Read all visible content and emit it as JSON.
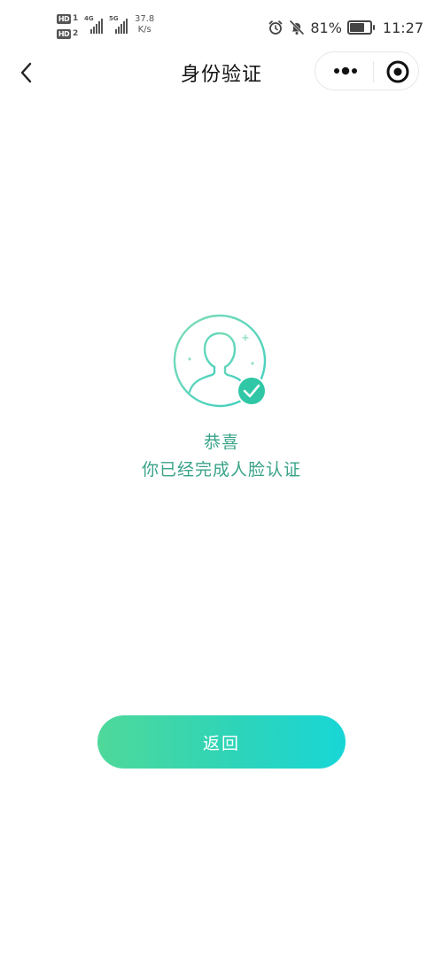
{
  "status_bar": {
    "hd1_label": "HD",
    "hd1_num": "1",
    "hd2_label": "HD",
    "hd2_num": "2",
    "sim1_gen": "4G",
    "sim2_gen": "5G",
    "net_speed_value": "37.8",
    "net_speed_unit": "K/s",
    "icons": [
      "alarm-icon",
      "mute-icon",
      "battery-icon"
    ],
    "battery_percent": "81%",
    "battery_level": 0.81,
    "time": "11:27"
  },
  "title_bar": {
    "title": "身份验证",
    "back_icon": "chevron-left-icon",
    "more_icon": "more-dots-icon",
    "close_icon": "target-close-icon"
  },
  "result": {
    "avatar_icon": "user-avatar-icon",
    "badge_icon": "check-badge-icon",
    "congrats": "恭喜",
    "message": "你已经完成人脸认证"
  },
  "actions": {
    "return_label": "返回"
  },
  "colors": {
    "accent": "#3aa38a",
    "avatar_ring": "#6fd6b8",
    "button_gradient_start": "#4fd99a",
    "button_gradient_end": "#18d6d6",
    "badge": "#2fc7a6"
  }
}
